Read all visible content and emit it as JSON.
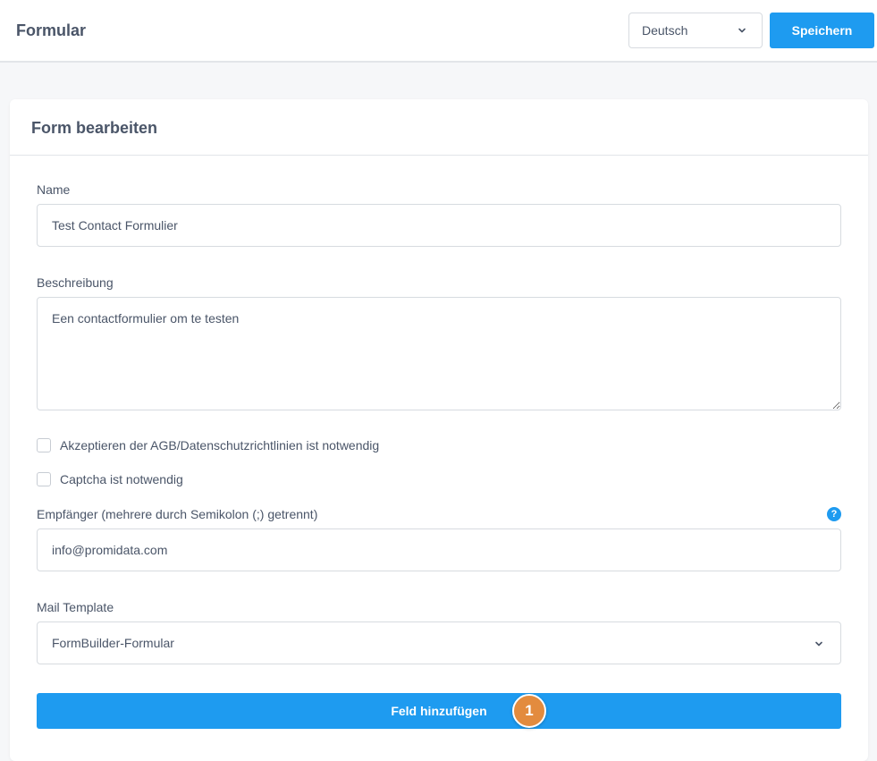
{
  "header": {
    "title": "Formular",
    "language": "Deutsch",
    "save_label": "Speichern"
  },
  "card": {
    "title": "Form bearbeiten",
    "name_label": "Name",
    "name_value": "Test Contact Formulier",
    "description_label": "Beschreibung",
    "description_value": "Een contactformulier om te testen",
    "terms_label": "Akzeptieren der AGB/Datenschutzrichtlinien ist notwendig",
    "terms_checked": false,
    "captcha_label": "Captcha ist notwendig",
    "captcha_checked": false,
    "recipient_label": "Empfänger (mehrere durch Semikolon (;) getrennt)",
    "recipient_value": "info@promidata.com",
    "help_icon": "?",
    "template_label": "Mail Template",
    "template_value": "FormBuilder-Formular",
    "add_field_label": "Feld hinzufügen",
    "step_badge": "1"
  },
  "colors": {
    "accent": "#1e9bf0",
    "badge": "#e38b3e",
    "text": "#4a5568",
    "border": "#d7dbe0"
  },
  "icons": {
    "language_dropdown": "chevron-down-icon",
    "template_dropdown": "chevron-down-icon",
    "recipient_help": "question-circle-icon"
  }
}
